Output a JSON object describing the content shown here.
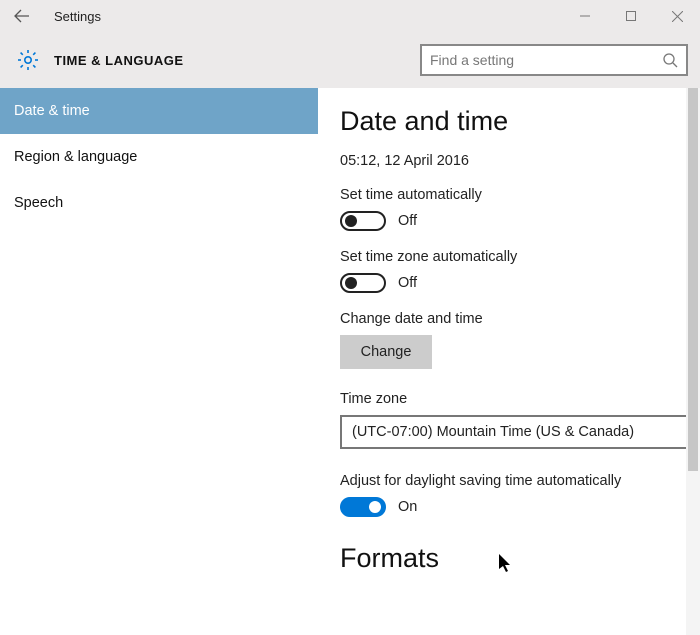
{
  "window": {
    "title": "Settings"
  },
  "header": {
    "section": "TIME & LANGUAGE",
    "search_placeholder": "Find a setting"
  },
  "sidebar": {
    "items": [
      {
        "label": "Date & time",
        "active": true
      },
      {
        "label": "Region & language",
        "active": false
      },
      {
        "label": "Speech",
        "active": false
      }
    ]
  },
  "main": {
    "title": "Date and time",
    "current_datetime": "05:12, 12 April 2016",
    "set_time_auto_label": "Set time automatically",
    "set_time_auto_state": "Off",
    "set_tz_auto_label": "Set time zone automatically",
    "set_tz_auto_state": "Off",
    "change_dt_label": "Change date and time",
    "change_btn": "Change",
    "tz_label": "Time zone",
    "tz_value": "(UTC-07:00) Mountain Time (US & Canada)",
    "dst_label": "Adjust for daylight saving time automatically",
    "dst_state": "On",
    "formats_heading": "Formats"
  }
}
